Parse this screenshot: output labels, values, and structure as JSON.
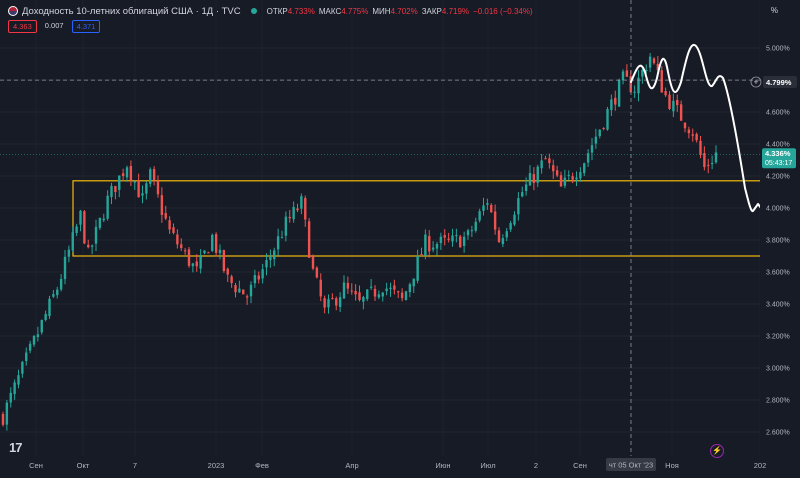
{
  "header": {
    "title": "Доходность 10-летних облигаций США · 1Д · TVC",
    "open_label": "ОТКР",
    "open_value": "4.733%",
    "high_label": "МАКС",
    "high_value": "4.775%",
    "low_label": "МИН",
    "low_value": "4.702%",
    "close_label": "ЗАКР",
    "close_value": "4.719%",
    "change_value": "−0.016 (−0.34%)"
  },
  "quote_boxes": {
    "bid": "4.363",
    "spread": "0.007",
    "ask": "4.371"
  },
  "unit_label": "%",
  "brand_logo": "17",
  "colors": {
    "up": "#26a69a",
    "down": "#ef5350",
    "box": "#f0b90b",
    "background": "#171b26"
  },
  "chart_data": {
    "type": "candlestick",
    "y_axis": {
      "ticks": [
        "5.000%",
        "4.800%",
        "4.600%",
        "4.400%",
        "4.200%",
        "4.000%",
        "3.800%",
        "3.600%",
        "3.400%",
        "3.200%",
        "3.000%",
        "2.800%",
        "2.600%"
      ],
      "ylim": [
        2.5,
        5.15
      ]
    },
    "x_axis": {
      "ticks": [
        "Сен",
        "Окт",
        "7",
        "2023",
        "Фев",
        "Апр",
        "Июн",
        "Июл",
        "2",
        "Сен",
        "Ноя",
        "202"
      ],
      "highlight": "чт 05 Окт '23"
    },
    "crosshair_price": "4.799%",
    "last_price": "4.336%",
    "countdown": "05:43:17",
    "zone": {
      "low": 3.7,
      "high": 4.17
    },
    "path_points": [
      {
        "t": 0,
        "v": 2.7
      },
      {
        "t": 6,
        "v": 3.05
      },
      {
        "t": 14,
        "v": 3.5
      },
      {
        "t": 20,
        "v": 3.95
      },
      {
        "t": 22,
        "v": 3.7
      },
      {
        "t": 27,
        "v": 4.05
      },
      {
        "t": 32,
        "v": 4.28
      },
      {
        "t": 36,
        "v": 4.05
      },
      {
        "t": 38,
        "v": 4.2
      },
      {
        "t": 43,
        "v": 3.85
      },
      {
        "t": 50,
        "v": 3.6
      },
      {
        "t": 54,
        "v": 3.82
      },
      {
        "t": 58,
        "v": 3.55
      },
      {
        "t": 63,
        "v": 3.45
      },
      {
        "t": 68,
        "v": 3.65
      },
      {
        "t": 73,
        "v": 3.9
      },
      {
        "t": 77,
        "v": 4.03
      },
      {
        "t": 80,
        "v": 3.6
      },
      {
        "t": 83,
        "v": 3.35
      },
      {
        "t": 88,
        "v": 3.5
      },
      {
        "t": 92,
        "v": 3.4
      },
      {
        "t": 98,
        "v": 3.52
      },
      {
        "t": 103,
        "v": 3.42
      },
      {
        "t": 109,
        "v": 3.78
      },
      {
        "t": 115,
        "v": 3.78
      },
      {
        "t": 120,
        "v": 3.82
      },
      {
        "t": 125,
        "v": 4.05
      },
      {
        "t": 128,
        "v": 3.8
      },
      {
        "t": 134,
        "v": 4.1
      },
      {
        "t": 140,
        "v": 4.3
      },
      {
        "t": 144,
        "v": 4.12
      },
      {
        "t": 150,
        "v": 4.3
      },
      {
        "t": 155,
        "v": 4.55
      },
      {
        "t": 160,
        "v": 4.8
      },
      {
        "t": 163,
        "v": 4.75
      },
      {
        "t": 167,
        "v": 4.95
      },
      {
        "t": 171,
        "v": 4.7
      },
      {
        "t": 174,
        "v": 4.6
      },
      {
        "t": 178,
        "v": 4.48
      },
      {
        "t": 181,
        "v": 4.25
      },
      {
        "t": 184,
        "v": 4.34
      }
    ]
  }
}
